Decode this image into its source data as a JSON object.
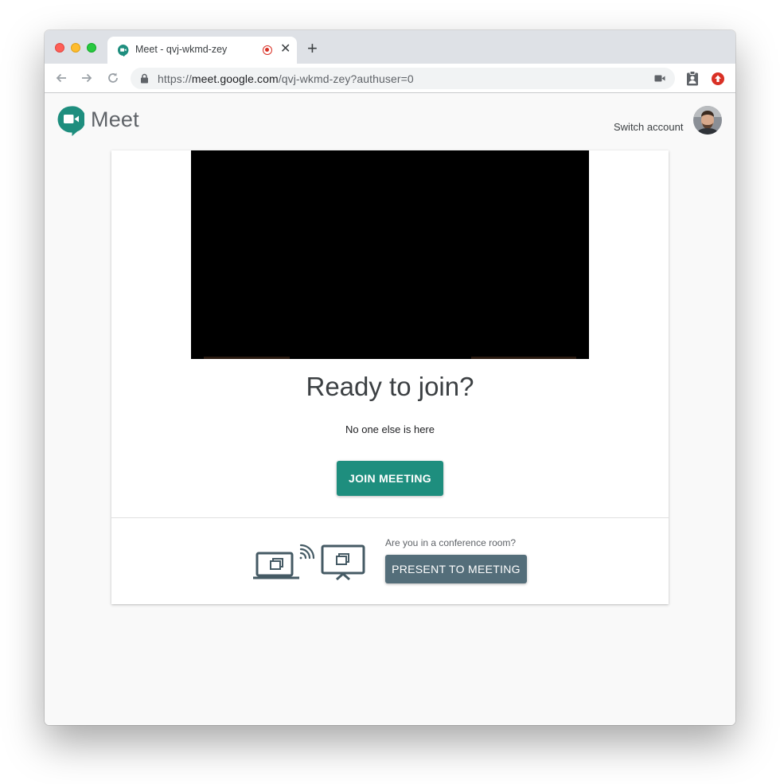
{
  "browser": {
    "tab": {
      "title": "Meet - qvj-wkmd-zey",
      "close_glyph": "✕",
      "favicon": "meet-favicon-icon",
      "recording_indicator": "recording-dot-icon"
    },
    "new_tab_glyph": "+",
    "url": {
      "scheme": "https://",
      "host": "meet.google.com",
      "path": "/qvj-wkmd-zey?authuser=0"
    },
    "nav_icons": [
      "back-arrow-icon",
      "forward-arrow-icon",
      "reload-icon"
    ],
    "extension_icons": [
      "camera-indicator-icon",
      "contact-badge-icon",
      "red-upload-icon"
    ]
  },
  "header": {
    "app_name": "Meet",
    "switch_account_label": "Switch account"
  },
  "main": {
    "heading": "Ready to join?",
    "status": "No one else is here",
    "join_button_label": "JOIN MEETING",
    "conference_question": "Are you in a conference room?",
    "present_button_label": "PRESENT TO MEETING"
  },
  "colors": {
    "join_button": "#1e8e7e",
    "present_button": "#546e7a",
    "meet_logo": "#1e8e7e",
    "record_dot": "#d93025"
  }
}
